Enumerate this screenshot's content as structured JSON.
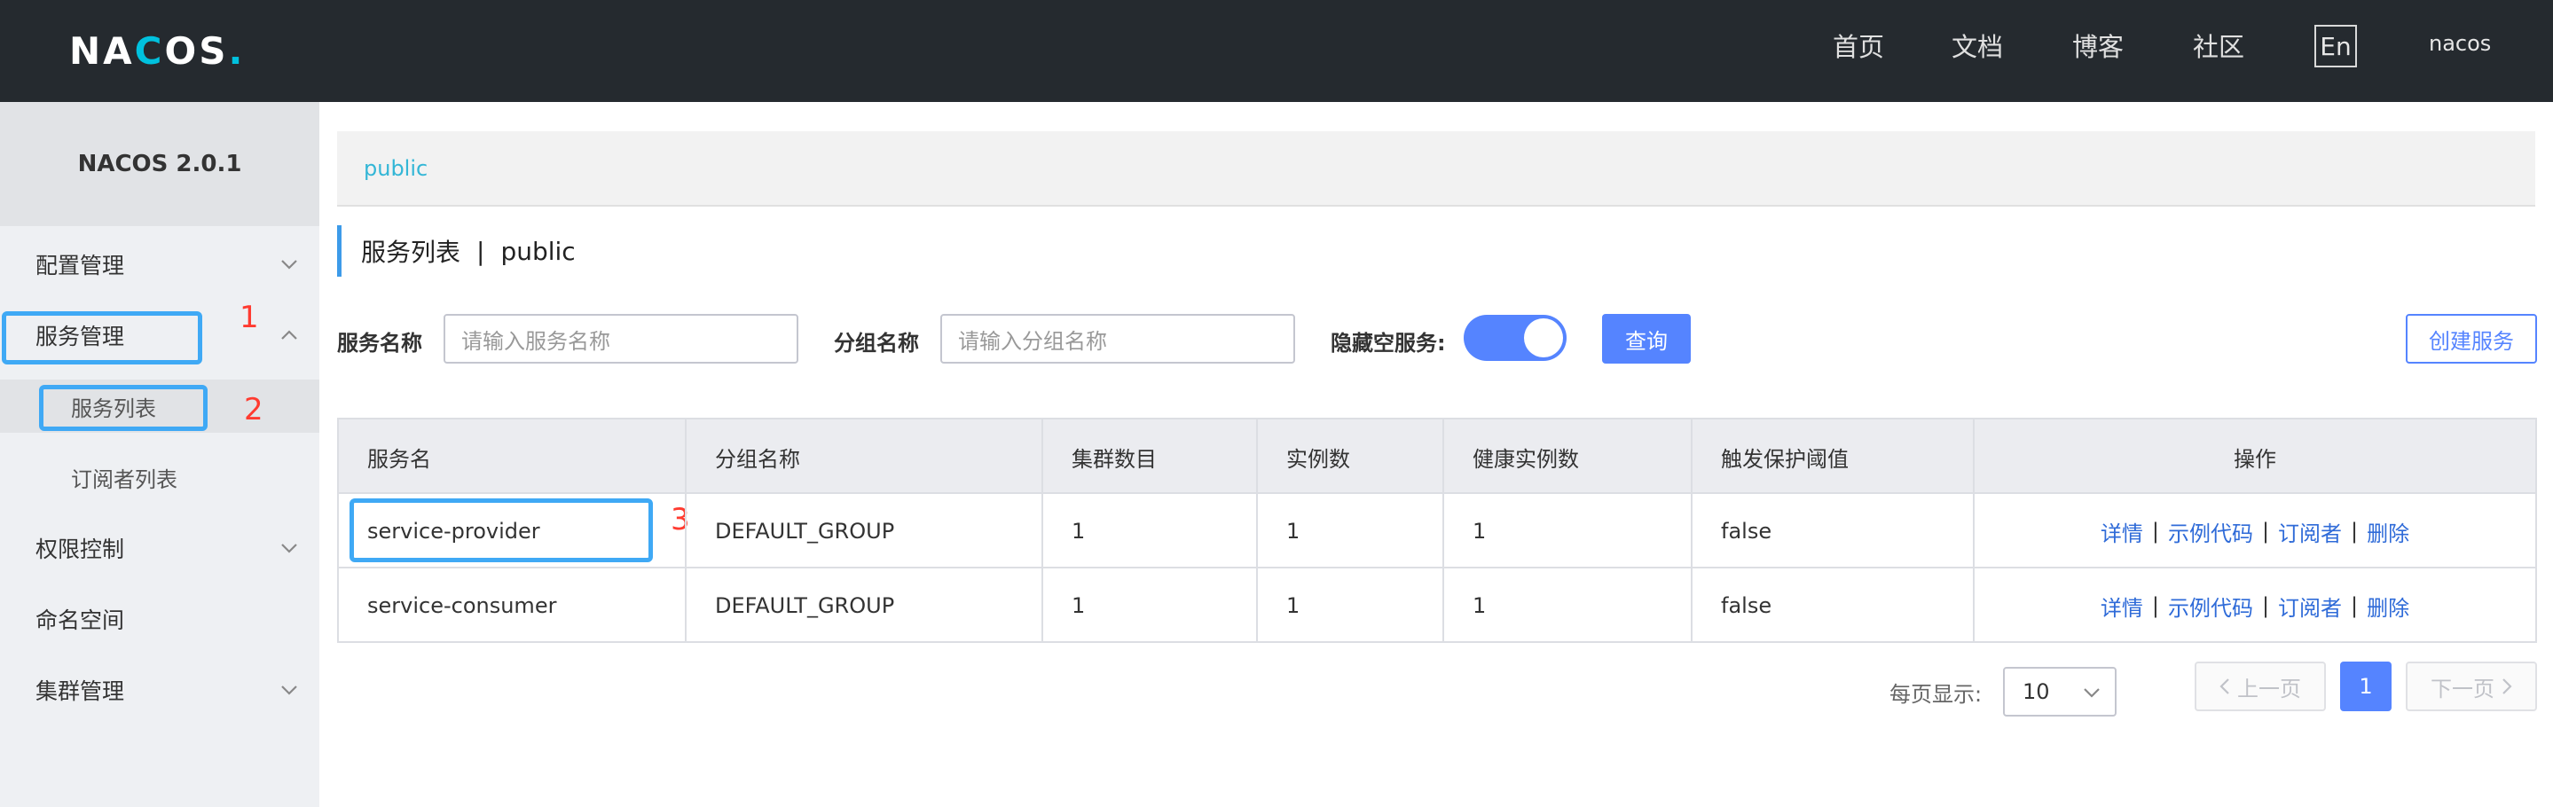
{
  "header": {
    "logo_parts": [
      "NA",
      "C",
      "O",
      "S",
      "."
    ],
    "nav": [
      "首页",
      "文档",
      "博客",
      "社区"
    ],
    "lang": "En",
    "user": "nacos"
  },
  "sidebar": {
    "title": "NACOS 2.0.1",
    "items": [
      {
        "label": "配置管理",
        "chevron": "down"
      },
      {
        "label": "服务管理",
        "chevron": "up"
      },
      {
        "label": "服务列表"
      },
      {
        "label": "订阅者列表"
      },
      {
        "label": "权限控制",
        "chevron": "down"
      },
      {
        "label": "命名空间"
      },
      {
        "label": "集群管理",
        "chevron": "down"
      }
    ]
  },
  "annotations": [
    "1",
    "2",
    "3"
  ],
  "namespace": {
    "link": "public"
  },
  "page_title": {
    "main": "服务列表",
    "sep": "|",
    "ns": "public"
  },
  "filters": {
    "service_label": "服务名称",
    "service_placeholder": "请输入服务名称",
    "group_label": "分组名称",
    "group_placeholder": "请输入分组名称",
    "hide_empty_label": "隐藏空服务:",
    "hide_empty_on": true,
    "query_button": "查询",
    "create_button": "创建服务"
  },
  "table": {
    "headers": [
      "服务名",
      "分组名称",
      "集群数目",
      "实例数",
      "健康实例数",
      "触发保护阈值",
      "操作"
    ],
    "rows": [
      [
        "service-provider",
        "DEFAULT_GROUP",
        "1",
        "1",
        "1",
        "false"
      ],
      [
        "service-consumer",
        "DEFAULT_GROUP",
        "1",
        "1",
        "1",
        "false"
      ]
    ],
    "ops": [
      "详情",
      "示例代码",
      "订阅者",
      "删除"
    ],
    "op_sep": "|"
  },
  "pagination": {
    "page_size_label": "每页显示:",
    "page_size": "10",
    "prev": "上一页",
    "current": "1",
    "next": "下一页"
  },
  "colors": {
    "header_bg": "#252a2f",
    "primary": "#5584ff",
    "accent": "#00c1de",
    "annotation": "#3fa9f5",
    "annotation_num": "#ff3b30"
  }
}
